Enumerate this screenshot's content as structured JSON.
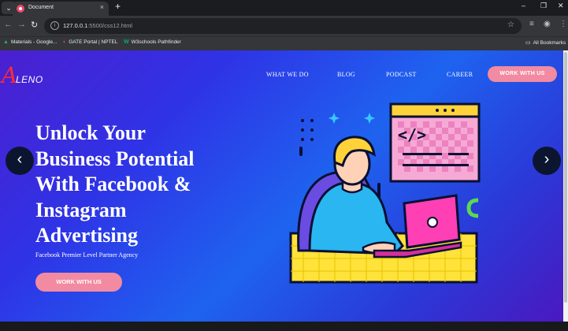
{
  "browser": {
    "tab_menu_glyph": "⌄",
    "tab_title": "Document",
    "tab_close": "×",
    "new_tab": "+",
    "window_controls": [
      "–",
      "❐",
      "✕"
    ],
    "nav_buttons": [
      "←",
      "→",
      "↻"
    ],
    "url_host": "127.0.0.1",
    "url_rest": ":5500/css12.html",
    "bookmarks": [
      {
        "label": "Materials - Google...",
        "icon": "drive-icon"
      },
      {
        "label": "GATE Portal | NPTEL",
        "icon": "nptel-icon"
      },
      {
        "label": "W3schools Pathfinder",
        "icon": "w3schools-icon"
      }
    ],
    "all_bookmarks": "All Bookmarks"
  },
  "site": {
    "logo_letter": "A",
    "logo_text": "LENO",
    "nav": [
      "WHAT WE DO",
      "BLOG",
      "PODCAST",
      "CAREER"
    ],
    "nav_cta": "WORK WITH US",
    "headline_lines": [
      "Unlock Your",
      "Business Potential",
      "With Facebook &",
      "Instagram",
      "Advertising"
    ],
    "subline": "Facebook Premier Level Partner Agency",
    "hero_cta": "WORK WITH US",
    "prev_arrow": "‹",
    "next_arrow": "›",
    "code_glyph": "</>"
  },
  "colors": {
    "accent_pink": "#f28ba1",
    "logo_red": "#ff2a36",
    "hero_grad_start": "#4b1fd0",
    "hero_grad_mid": "#1e63ef"
  }
}
